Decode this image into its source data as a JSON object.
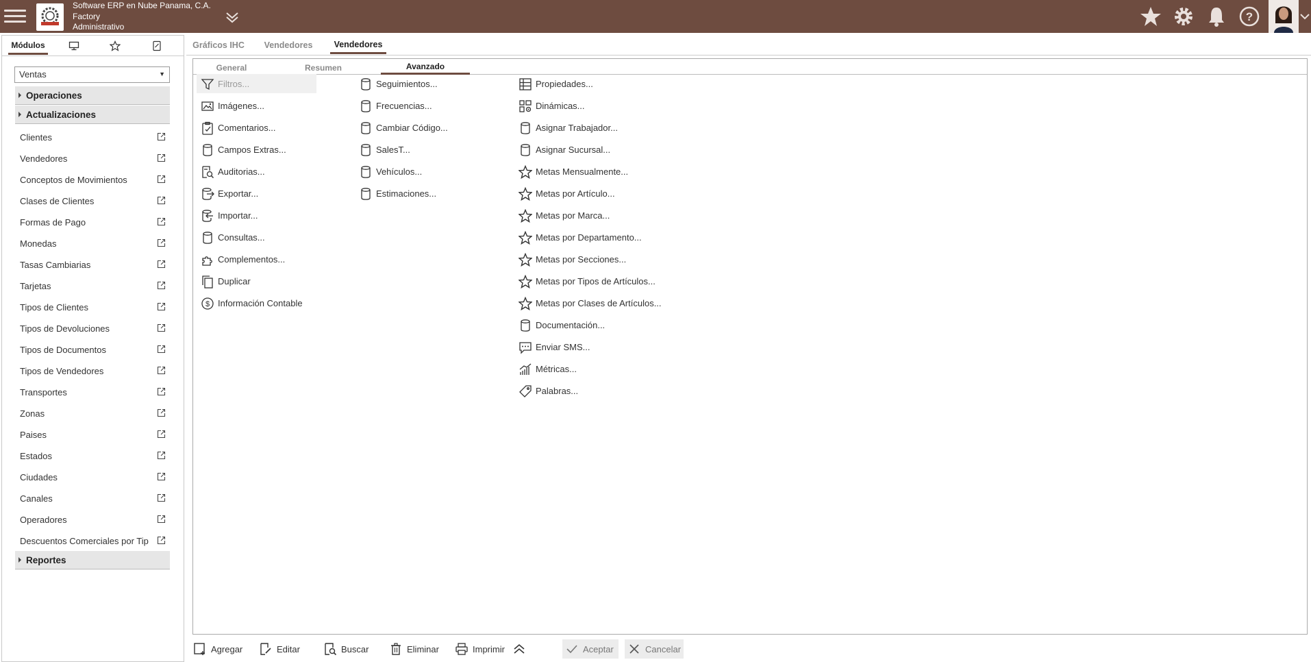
{
  "header": {
    "company_line1": "Software ERP en Nube Panama, C.A.",
    "company_line2": "Factory",
    "company_line3": "Administrativo",
    "icons": [
      "menu-icon",
      "star-icon",
      "gear-icon",
      "bell-icon",
      "help-icon"
    ]
  },
  "left_panel": {
    "tabs": [
      {
        "label": "Módulos",
        "icon": null
      },
      {
        "label": "",
        "icon": "monitor-icon"
      },
      {
        "label": "",
        "icon": "star-icon"
      },
      {
        "label": "",
        "icon": "notepad-icon"
      }
    ],
    "module_select": "Ventas",
    "sections": {
      "operaciones": "Operaciones",
      "actualizaciones": "Actualizaciones",
      "reportes": "Reportes"
    },
    "items": [
      "Clientes",
      "Vendedores",
      "Conceptos de Movimientos",
      "Clases de Clientes",
      "Formas de Pago",
      "Monedas",
      "Tasas Cambiarias",
      "Tarjetas",
      "Tipos de Clientes",
      "Tipos de Devoluciones",
      "Tipos de Documentos",
      "Tipos de Vendedores",
      "Transportes",
      "Zonas",
      "Paises",
      "Estados",
      "Ciudades",
      "Canales",
      "Operadores",
      "Descuentos Comerciales por Tipos"
    ]
  },
  "main_tabs": [
    "Gráficos IHC",
    "Vendedores",
    "Vendedores"
  ],
  "sub_tabs": [
    "General",
    "Resumen",
    "Avanzado"
  ],
  "options": {
    "col1": [
      {
        "label": "Filtros...",
        "icon": "filter-icon"
      },
      {
        "label": "Imágenes...",
        "icon": "image-icon"
      },
      {
        "label": "Comentarios...",
        "icon": "clipboard-check-icon"
      },
      {
        "label": "Campos Extras...",
        "icon": "database-icon"
      },
      {
        "label": "Auditorias...",
        "icon": "audit-search-icon"
      },
      {
        "label": "Exportar...",
        "icon": "export-icon"
      },
      {
        "label": "Importar...",
        "icon": "import-icon"
      },
      {
        "label": "Consultas...",
        "icon": "database-icon"
      },
      {
        "label": "Complementos...",
        "icon": "puzzle-icon"
      },
      {
        "label": "Duplicar",
        "icon": "copy-icon"
      },
      {
        "label": "Información Contable",
        "icon": "dollar-circle-icon"
      }
    ],
    "col2": [
      {
        "label": "Seguimientos...",
        "icon": "database-icon"
      },
      {
        "label": "Frecuencias...",
        "icon": "database-icon"
      },
      {
        "label": "Cambiar Código...",
        "icon": "database-icon"
      },
      {
        "label": "SalesT...",
        "icon": "database-icon"
      },
      {
        "label": "Vehículos...",
        "icon": "database-icon"
      },
      {
        "label": "Estimaciones...",
        "icon": "database-icon"
      }
    ],
    "col3": [
      {
        "label": "Propiedades...",
        "icon": "properties-icon"
      },
      {
        "label": "Dinámicas...",
        "icon": "dynamics-icon"
      },
      {
        "label": "Asignar Trabajador...",
        "icon": "database-icon"
      },
      {
        "label": "Asignar Sucursal...",
        "icon": "database-icon"
      },
      {
        "label": "Metas Mensualmente...",
        "icon": "star-outline-icon"
      },
      {
        "label": "Metas por Artículo...",
        "icon": "star-outline-icon"
      },
      {
        "label": "Metas por Marca...",
        "icon": "star-outline-icon"
      },
      {
        "label": "Metas por Departamento...",
        "icon": "star-outline-icon"
      },
      {
        "label": "Metas por Secciones...",
        "icon": "star-outline-icon"
      },
      {
        "label": "Metas por Tipos de Artículos...",
        "icon": "star-outline-icon"
      },
      {
        "label": "Metas por Clases de Artículos...",
        "icon": "star-outline-icon"
      },
      {
        "label": "Documentación...",
        "icon": "database-icon"
      },
      {
        "label": "Enviar SMS...",
        "icon": "sms-icon"
      },
      {
        "label": "Métricas...",
        "icon": "metrics-icon"
      },
      {
        "label": "Palabras...",
        "icon": "tag-icon"
      }
    ]
  },
  "toolbar": {
    "agregar": "Agregar",
    "editar": "Editar",
    "buscar": "Buscar",
    "eliminar": "Eliminar",
    "imprimir": "Imprimir",
    "aceptar": "Aceptar",
    "cancelar": "Cancelar"
  },
  "colors": {
    "header_bg": "#6e4c40",
    "active_tab_underline": "#6e4c40"
  }
}
